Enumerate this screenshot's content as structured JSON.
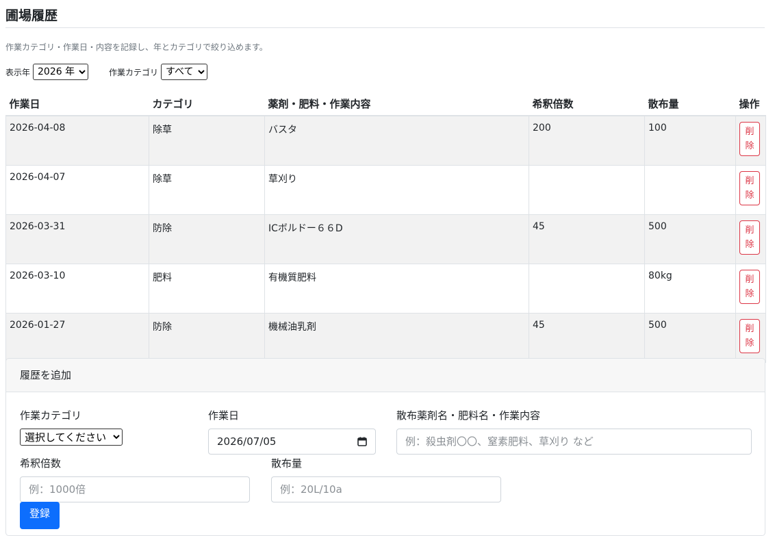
{
  "page": {
    "title": "圃場履歴",
    "description": "作業カテゴリ・作業日・内容を記録し、年とカテゴリで絞り込めます。"
  },
  "filters": {
    "year_label": "表示年",
    "year_value": "2026 年",
    "category_label": "作業カテゴリ",
    "category_value": "すべて"
  },
  "table": {
    "headers": [
      "作業日",
      "カテゴリ",
      "薬剤・肥料・作業内容",
      "希釈倍数",
      "散布量",
      "操作"
    ],
    "delete_label_top": "削",
    "delete_label_bottom": "除",
    "rows": [
      {
        "date": "2026-04-08",
        "category": "除草",
        "content": "バスタ",
        "dilution": "200",
        "amount": "100"
      },
      {
        "date": "2026-04-07",
        "category": "除草",
        "content": "草刈り",
        "dilution": "",
        "amount": ""
      },
      {
        "date": "2026-03-31",
        "category": "防除",
        "content": "ICボルドー６６D",
        "dilution": "45",
        "amount": "500"
      },
      {
        "date": "2026-03-10",
        "category": "肥料",
        "content": "有機質肥料",
        "dilution": "",
        "amount": "80kg"
      },
      {
        "date": "2026-01-27",
        "category": "防除",
        "content": "機械油乳剤",
        "dilution": "45",
        "amount": "500"
      }
    ]
  },
  "form": {
    "header": "履歴を追加",
    "category_label": "作業カテゴリ",
    "category_value": "選択してください",
    "date_label": "作業日",
    "date_value": "2026/07/05",
    "content_label": "散布薬剤名・肥料名・作業内容",
    "content_placeholder": "例：殺虫剤〇〇、窒素肥料、草刈り など",
    "dilution_label": "希釈倍数",
    "dilution_placeholder": "例：1000倍",
    "amount_label": "散布量",
    "amount_placeholder": "例：20L/10a",
    "submit_label": "登録"
  },
  "colors": {
    "danger": "#dc3545",
    "primary": "#0d6efd",
    "stripe": "#f2f2f2",
    "border": "#dee2e6"
  },
  "icons": {
    "date_picker": "calendar-icon"
  }
}
